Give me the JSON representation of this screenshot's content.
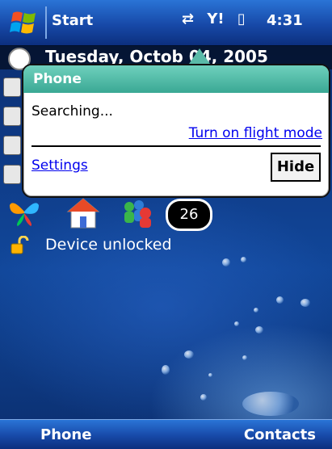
{
  "topbar": {
    "start_label": "Start",
    "clock": "4:31",
    "status_icons": [
      "connectivity-icon",
      "signal-icon",
      "vibrate-icon"
    ]
  },
  "today": {
    "date": "Tuesday, Octob   04, 2005",
    "launcher_badge": "26",
    "device_status": "Device unlocked"
  },
  "bubble": {
    "title": "Phone",
    "message": "Searching...",
    "flight_mode_link": "Turn on flight mode",
    "settings_link": "Settings",
    "hide_button": "Hide"
  },
  "softkeys": {
    "left": "Phone",
    "right": "Contacts"
  },
  "colors": {
    "topbar": "#1749a8",
    "bubble_header": "#3aa894",
    "link": "#0000ee"
  }
}
